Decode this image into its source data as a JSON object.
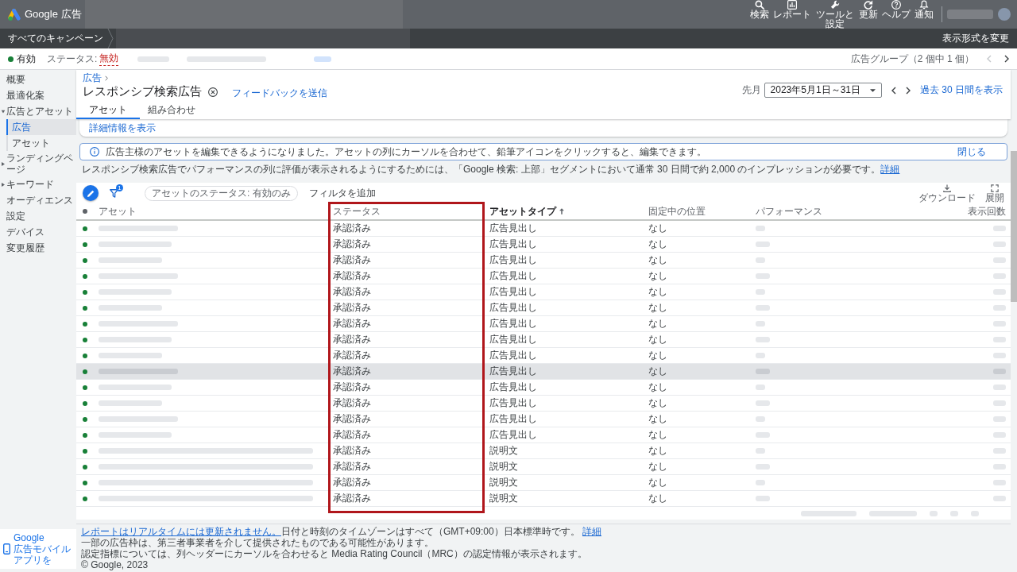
{
  "top_bar": {
    "product_name": "Google 広告",
    "actions": [
      {
        "label": "検索"
      },
      {
        "label": "レポート"
      },
      {
        "label": "ツールと設定"
      },
      {
        "label": "更新"
      },
      {
        "label": "ヘルプ"
      },
      {
        "label": "通知"
      }
    ]
  },
  "breadcrumb_bar": {
    "root": "すべてのキャンペーン",
    "view_switch": "表示形式を変更"
  },
  "status_bar": {
    "state": "有効",
    "status_label": "ステータス:",
    "status_value": "無効",
    "ad_group_counter": "広告グループ（2 個中 1 個）",
    "previous": {
      "disabled": true
    },
    "next": {
      "disabled": false
    }
  },
  "sidebar": {
    "items": [
      {
        "label": "概要",
        "kind": "link",
        "selected": false
      },
      {
        "label": "最適化案",
        "kind": "link",
        "selected": false
      },
      {
        "label": "広告とアセット",
        "kind": "group",
        "expanded": true,
        "selected": false,
        "children": [
          {
            "label": "広告",
            "kind": "link",
            "selected": true
          },
          {
            "label": "アセット",
            "kind": "link",
            "selected": false
          }
        ]
      },
      {
        "label": "ランディングページ",
        "kind": "group",
        "expanded": false,
        "selected": false
      },
      {
        "label": "キーワード",
        "kind": "group",
        "expanded": false,
        "selected": false
      },
      {
        "label": "オーディエンス",
        "kind": "link",
        "selected": false
      },
      {
        "label": "設定",
        "kind": "link",
        "selected": false
      },
      {
        "label": "デバイス",
        "kind": "link",
        "selected": false
      },
      {
        "label": "変更履歴",
        "kind": "link",
        "selected": false
      }
    ],
    "promo": {
      "title": "Google",
      "text": "広告モバイルアプリを"
    }
  },
  "page_header": {
    "breadcrumb": "広告",
    "title": "レスポンシブ検索広告",
    "feedback_link": "フィードバックを送信",
    "date_preset": "先月",
    "date_range": "2023年5月1日～31日",
    "last_30_days_link": "過去 30 日間を表示",
    "tabs": [
      {
        "label": "アセット",
        "selected": true
      },
      {
        "label": "組み合わせ",
        "selected": false
      }
    ]
  },
  "details_card": {
    "link": "詳細情報を表示"
  },
  "info_banner": {
    "text": "広告主様のアセットを編集できるようになりました。アセットの列にカーソルを合わせて、鉛筆アイコンをクリックすると、編集できます。",
    "dismiss": "閉じる"
  },
  "notice": {
    "text": "レスポンシブ検索広告でパフォーマンスの列に評価が表示されるようにするためには、「Google 検索: 上部」セグメントにおいて通常 30 日間で約 2,000 のインプレッションが必要です。",
    "link": "詳細"
  },
  "table": {
    "toolbar": {
      "filter_count": "1",
      "filter_chip": "アセットのステータス: 有効のみ",
      "add_filter": "フィルタを追加",
      "download": "ダウンロード",
      "expand": "展開"
    },
    "columns": [
      {
        "label": "アセット",
        "sorted": false,
        "highlighted": false
      },
      {
        "label": "ステータス",
        "sorted": false,
        "highlighted": true
      },
      {
        "label": "アセットタイプ",
        "sorted": true,
        "highlighted": false
      },
      {
        "label": "固定中の位置",
        "sorted": false,
        "highlighted": false
      },
      {
        "label": "パフォーマンス",
        "sorted": false,
        "highlighted": false
      },
      {
        "label": "表示回数",
        "sorted": false,
        "highlighted": false
      }
    ],
    "rows": [
      {
        "status": "承認済み",
        "asset_type": "広告見出し",
        "pinned_position": "なし",
        "hovered": false
      },
      {
        "status": "承認済み",
        "asset_type": "広告見出し",
        "pinned_position": "なし",
        "hovered": false
      },
      {
        "status": "承認済み",
        "asset_type": "広告見出し",
        "pinned_position": "なし",
        "hovered": false
      },
      {
        "status": "承認済み",
        "asset_type": "広告見出し",
        "pinned_position": "なし",
        "hovered": false
      },
      {
        "status": "承認済み",
        "asset_type": "広告見出し",
        "pinned_position": "なし",
        "hovered": false
      },
      {
        "status": "承認済み",
        "asset_type": "広告見出し",
        "pinned_position": "なし",
        "hovered": false
      },
      {
        "status": "承認済み",
        "asset_type": "広告見出し",
        "pinned_position": "なし",
        "hovered": false
      },
      {
        "status": "承認済み",
        "asset_type": "広告見出し",
        "pinned_position": "なし",
        "hovered": false
      },
      {
        "status": "承認済み",
        "asset_type": "広告見出し",
        "pinned_position": "なし",
        "hovered": false
      },
      {
        "status": "承認済み",
        "asset_type": "広告見出し",
        "pinned_position": "なし",
        "hovered": true
      },
      {
        "status": "承認済み",
        "asset_type": "広告見出し",
        "pinned_position": "なし",
        "hovered": false
      },
      {
        "status": "承認済み",
        "asset_type": "広告見出し",
        "pinned_position": "なし",
        "hovered": false
      },
      {
        "status": "承認済み",
        "asset_type": "広告見出し",
        "pinned_position": "なし",
        "hovered": false
      },
      {
        "status": "承認済み",
        "asset_type": "広告見出し",
        "pinned_position": "なし",
        "hovered": false
      },
      {
        "status": "承認済み",
        "asset_type": "説明文",
        "pinned_position": "なし",
        "hovered": false
      },
      {
        "status": "承認済み",
        "asset_type": "説明文",
        "pinned_position": "なし",
        "hovered": false
      },
      {
        "status": "承認済み",
        "asset_type": "説明文",
        "pinned_position": "なし",
        "hovered": false
      },
      {
        "status": "承認済み",
        "asset_type": "説明文",
        "pinned_position": "なし",
        "hovered": false
      }
    ]
  },
  "footer": {
    "realtime_link": "レポートはリアルタイムには更新されません。",
    "timezone_note": "日付と時刻のタイムゾーンはすべて（GMT+09:00）日本標準時です。",
    "details_link": "詳細",
    "inventory_note": "一部の広告枠は、第三者事業者を介して提供されたものである可能性があります。",
    "mrc_note": "認定指標については、列ヘッダーにカーソルを合わせると Media Rating Council（MRC）の認定情報が表示されます。",
    "copyright": "© Google, 2023"
  }
}
